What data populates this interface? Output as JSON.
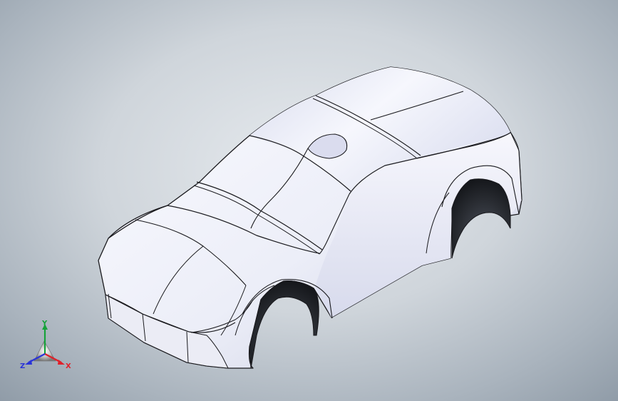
{
  "viewport": {
    "background_center": "#e6eaee",
    "background_edge": "#8e9aa6",
    "model_color": "#f4f5fb",
    "edge_color": "#1a1a1e"
  },
  "triad": {
    "x_label": "X",
    "y_label": "Y",
    "z_label": "Z",
    "x_color": "#e0202a",
    "y_color": "#16a23a",
    "z_color": "#2a34d8"
  }
}
